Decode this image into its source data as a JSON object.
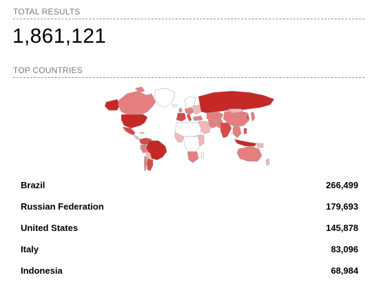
{
  "total_results": {
    "label": "TOTAL RESULTS",
    "value": "1,861,121"
  },
  "top_countries": {
    "label": "TOP COUNTRIES",
    "rows": [
      {
        "country": "Brazil",
        "count": "266,499"
      },
      {
        "country": "Russian Federation",
        "count": "179,693"
      },
      {
        "country": "United States",
        "count": "145,878"
      },
      {
        "country": "Italy",
        "count": "83,096"
      },
      {
        "country": "Indonesia",
        "count": "68,984"
      }
    ]
  },
  "colors": {
    "highest": "#c62828",
    "high": "#d84a4a",
    "medium": "#e57f7f",
    "low": "#f2b8b8",
    "none": "#ffffff",
    "border": "#9e9e9e"
  }
}
